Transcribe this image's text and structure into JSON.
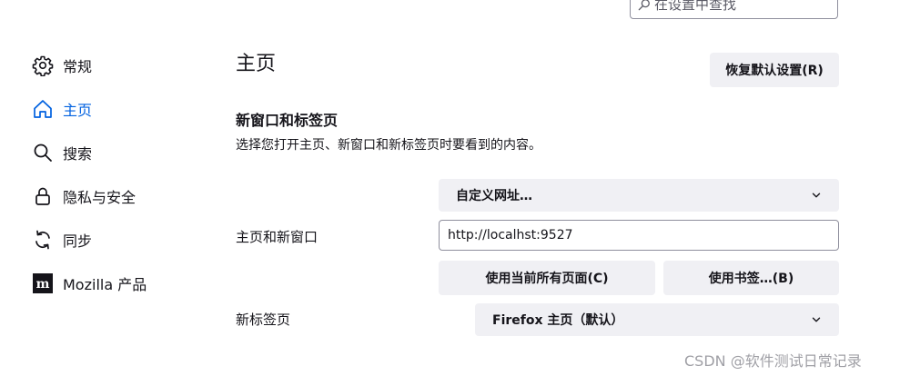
{
  "search": {
    "placeholder": "在设置中查找"
  },
  "sidebar": {
    "items": [
      {
        "label": "常规",
        "icon": "gear-icon"
      },
      {
        "label": "主页",
        "icon": "home-icon",
        "selected": true
      },
      {
        "label": "搜索",
        "icon": "search-icon"
      },
      {
        "label": "隐私与安全",
        "icon": "lock-icon"
      },
      {
        "label": "同步",
        "icon": "sync-icon"
      },
      {
        "label": "Mozilla 产品",
        "icon": "mozilla-logo-icon"
      }
    ]
  },
  "main": {
    "title": "主页",
    "restore_button": "恢复默认设置(R)",
    "section": {
      "title": "新窗口和标签页",
      "description": "选择您打开主页、新窗口和新标签页时要看到的内容。"
    },
    "homepage": {
      "label": "主页和新窗口",
      "select_value": "自定义网址…",
      "url_value": "http://localhst:9527",
      "use_current_pages_button": "使用当前所有页面(C)",
      "use_bookmark_button": "使用书签…(B)"
    },
    "new_tab": {
      "label": "新标签页",
      "select_value": "Firefox 主页（默认）"
    }
  },
  "watermark": "CSDN @软件测试日常记录",
  "colors": {
    "accent": "#0061e0",
    "button_bg": "#f0f0f4",
    "text": "#15141a"
  }
}
